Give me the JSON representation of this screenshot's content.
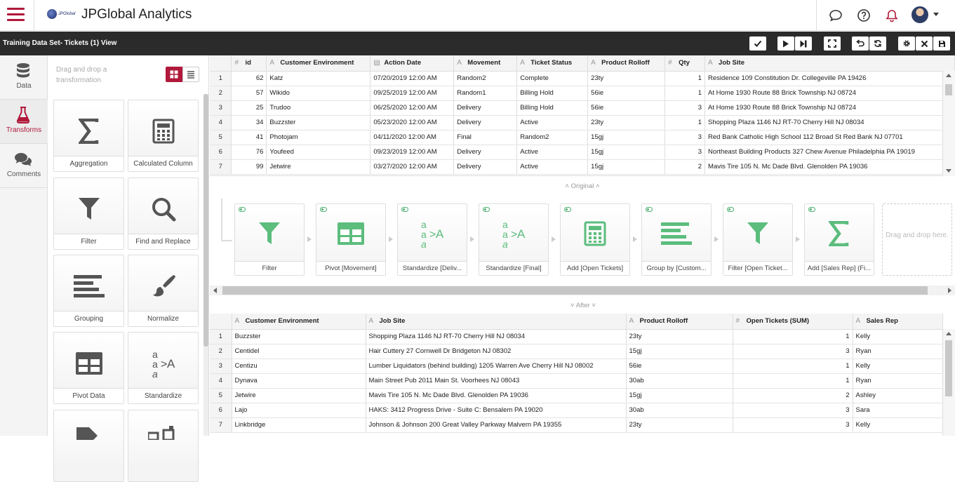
{
  "header": {
    "logo_text": "JPGlobal",
    "app_title": "JPGlobal Analytics",
    "icons": [
      "chat-icon",
      "help-icon",
      "bell-icon",
      "avatar",
      "caret-down-icon"
    ]
  },
  "toolbar": {
    "view_title": "Training Data Set- Tickets (1) View",
    "buttons": [
      "check-icon",
      "play-icon",
      "step-icon",
      "expand-icon",
      "undo-icon",
      "refresh-icon",
      "gear-icon",
      "close-icon",
      "save-icon"
    ]
  },
  "nav": {
    "items": [
      {
        "label": "Data",
        "icon": "database-icon"
      },
      {
        "label": "Transforms",
        "icon": "flask-icon"
      },
      {
        "label": "Comments",
        "icon": "comments-icon"
      }
    ]
  },
  "palette": {
    "hint": "Drag and drop a transformation",
    "tiles": [
      {
        "label": "Aggregation",
        "icon": "sigma-icon"
      },
      {
        "label": "Calculated Column",
        "icon": "calculator-icon"
      },
      {
        "label": "Filter",
        "icon": "filter-icon"
      },
      {
        "label": "Find and Replace",
        "icon": "search-icon"
      },
      {
        "label": "Grouping",
        "icon": "grouping-icon"
      },
      {
        "label": "Normalize",
        "icon": "brush-icon"
      },
      {
        "label": "Pivot Data",
        "icon": "pivot-icon"
      },
      {
        "label": "Standardize",
        "icon": "standardize-icon"
      }
    ]
  },
  "top_table": {
    "columns": [
      {
        "label": "id",
        "type": "#"
      },
      {
        "label": "Customer Environment",
        "type": "A"
      },
      {
        "label": "Action Date",
        "type": "cal"
      },
      {
        "label": "Movement",
        "type": "A"
      },
      {
        "label": "Ticket Status",
        "type": "A"
      },
      {
        "label": "Product Rolloff",
        "type": "A"
      },
      {
        "label": "Qty",
        "type": "#"
      },
      {
        "label": "Job Site",
        "type": "A"
      }
    ],
    "rows": [
      [
        "1",
        "62",
        "Katz",
        "07/20/2019 12:00 AM",
        "Random2",
        "Complete",
        "23ty",
        "1",
        "Residence 109 Constitution Dr. Collegeville PA 19426"
      ],
      [
        "2",
        "57",
        "Wikido",
        "09/25/2019 12:00 AM",
        "Random1",
        "Billing Hold",
        "56ie",
        "1",
        "At Home 1930 Route 88 Brick Township NJ 08724"
      ],
      [
        "3",
        "25",
        "Trudoo",
        "06/25/2020 12:00 AM",
        "Delivery",
        "Billing Hold",
        "56ie",
        "3",
        "At Home 1930 Route 88 Brick Township NJ 08724"
      ],
      [
        "4",
        "34",
        "Buzzster",
        "05/23/2020 12:00 AM",
        "Delivery",
        "Active",
        "23ty",
        "1",
        "Shopping Plaza 1146 NJ RT-70 Cherry Hill NJ 08034"
      ],
      [
        "5",
        "41",
        "Photojam",
        "04/11/2020 12:00 AM",
        "Final",
        "Random2",
        "15gj",
        "3",
        "Red Bank Catholic High School 112 Broad St Red Bank NJ 07701"
      ],
      [
        "6",
        "76",
        "Youfeed",
        "09/23/2019 12:00 AM",
        "Delivery",
        "Active",
        "15gj",
        "3",
        "Northeast Building Products 327 Chew Avenue Philadelphia PA 19019"
      ],
      [
        "7",
        "99",
        "Jetwire",
        "03/27/2020 12:00 AM",
        "Delivery",
        "Active",
        "15gj",
        "2",
        "Mavis Tire 105 N. Mc Dade Blvd. Glenolden PA 19036"
      ]
    ]
  },
  "labels": {
    "original": "Original",
    "after": "After"
  },
  "pipeline": {
    "steps": [
      {
        "label": "Filter",
        "icon": "filter-icon"
      },
      {
        "label": "Pivot [Movement]",
        "icon": "pivot-icon"
      },
      {
        "label": "Standardize [Deliv...",
        "icon": "standardize-icon"
      },
      {
        "label": "Standardize [Final]",
        "icon": "standardize-icon"
      },
      {
        "label": "Add [Open Tickets]",
        "icon": "calculator-icon"
      },
      {
        "label": "Group by [Custom...",
        "icon": "grouping-icon"
      },
      {
        "label": "Filter [Open Ticket...",
        "icon": "filter-icon"
      },
      {
        "label": "Add [Sales Rep] (Fi...",
        "icon": "sigma-icon"
      }
    ],
    "drop_hint": "Drag and drop here."
  },
  "bottom_table": {
    "columns": [
      {
        "label": "Customer Environment",
        "type": "A"
      },
      {
        "label": "Job Site",
        "type": "A"
      },
      {
        "label": "Product Rolloff",
        "type": "A"
      },
      {
        "label": "Open Tickets (SUM)",
        "type": "#"
      },
      {
        "label": "Sales Rep",
        "type": "A"
      }
    ],
    "rows": [
      [
        "1",
        "Buzzster",
        "Shopping Plaza 1146 NJ RT-70 Cherry Hill NJ 08034",
        "23ty",
        "1",
        "Kelly"
      ],
      [
        "2",
        "Centidel",
        "Hair Cuttery 27 Cornwell Dr Bridgeton NJ 08302",
        "15gj",
        "3",
        "Ryan"
      ],
      [
        "3",
        "Centizu",
        "Lumber Liquidators (behind building) 1205 Warren Ave Cherry Hill NJ 08002",
        "56ie",
        "1",
        "Kelly"
      ],
      [
        "4",
        "Dynava",
        "Main Street Pub 2011 Main St. Voorhees NJ 08043",
        "30ab",
        "1",
        "Ryan"
      ],
      [
        "5",
        "Jetwire",
        "Mavis Tire 105 N. Mc Dade Blvd. Glenolden PA 19036",
        "15gj",
        "2",
        "Ashley"
      ],
      [
        "6",
        "Lajo",
        "HAKS: 3412 Progress Drive - Suite C: Bensalem PA 19020",
        "30ab",
        "3",
        "Sara"
      ],
      [
        "7",
        "Linkbridge",
        "Johnson & Johnson 200 Great Valley Parkway Malvern PA 19355",
        "23ty",
        "3",
        "Kelly"
      ]
    ]
  },
  "colors": {
    "brand": "#b0193a",
    "step_icon": "#5cbd7d",
    "palette_icon": "#555555"
  }
}
